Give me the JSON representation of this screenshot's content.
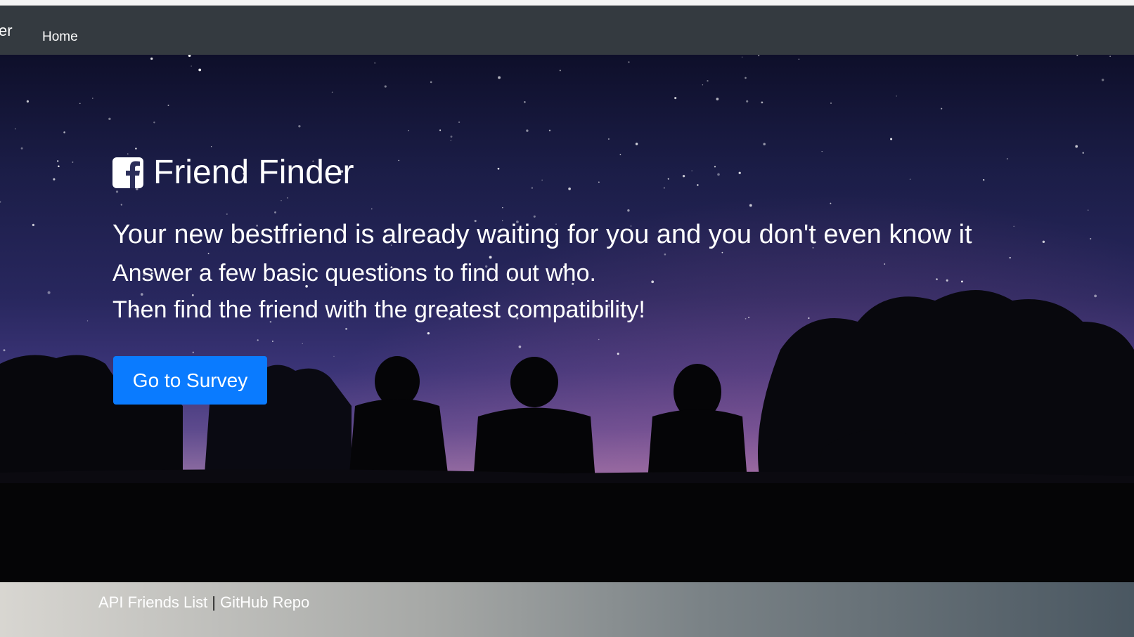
{
  "navbar": {
    "brand_fragment": "er",
    "home_label": "Home"
  },
  "hero": {
    "icon": "facebook-square-icon",
    "title": "Friend Finder",
    "lead": "Your new bestfriend is already waiting for you and you don't even know it",
    "line2": "Answer a few basic questions to find out who.",
    "line3": "Then find the friend with the greatest compatibility!",
    "button_label": "Go to Survey",
    "button_color": "#0a7bff"
  },
  "footer": {
    "link1": "API Friends List",
    "separator": "|",
    "link2": "GitHub Repo"
  }
}
